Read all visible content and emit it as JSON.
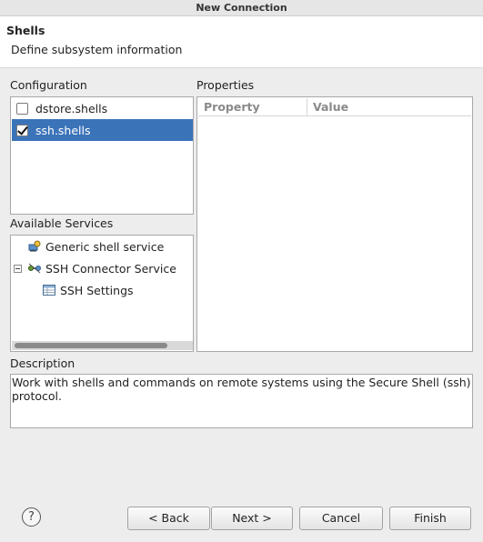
{
  "window": {
    "title": "New Connection"
  },
  "header": {
    "title": "Shells",
    "description": "Define subsystem information"
  },
  "configuration": {
    "label": "Configuration",
    "items": [
      {
        "label": "dstore.shells",
        "checked": false,
        "selected": false
      },
      {
        "label": "ssh.shells",
        "checked": true,
        "selected": true
      }
    ]
  },
  "properties": {
    "label": "Properties",
    "columns": [
      "Property",
      "Value"
    ]
  },
  "services": {
    "label": "Available Services",
    "items": [
      {
        "label": "Generic shell service",
        "icon": "shell-service-icon"
      },
      {
        "label": "SSH Connector Service",
        "icon": "connector-service-icon",
        "expanded": true
      },
      {
        "label": "SSH Settings",
        "icon": "settings-table-icon"
      }
    ]
  },
  "description": {
    "label": "Description",
    "text": "Work with shells and commands on remote systems using the Secure Shell (ssh) protocol."
  },
  "buttons": {
    "help": "?",
    "back": "< Back",
    "next": "Next >",
    "cancel": "Cancel",
    "finish": "Finish"
  },
  "colors": {
    "selection": "#3b73b9",
    "header_bg": "#ffffff",
    "dialog_bg": "#ededed"
  }
}
